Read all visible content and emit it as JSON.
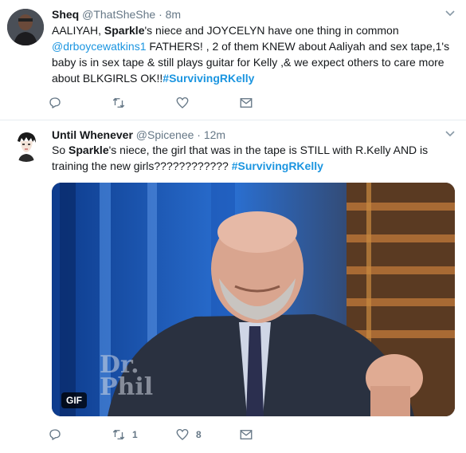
{
  "tweets": [
    {
      "name": "Sheq",
      "handle": "@ThatSheShe",
      "sep": "·",
      "time": "8m",
      "text": {
        "p1": "AALIYAH, ",
        "b1": "Sparkle",
        "p2": "'s niece and JOYCELYN have one thing in common ",
        "mention": "@drboycewatkins1",
        "p3": "  FATHERS! , 2 of them KNEW about Aaliyah and sex tape,1's baby is in sex tape & still  plays guitar for Kelly ,& we expect others to care more about BLKGIRLS OK!!",
        "hashtag": "#SurvivingRKelly"
      },
      "actions": {
        "reply": "",
        "retweet": "",
        "like": ""
      }
    },
    {
      "name": "Until Whenever",
      "handle": "@Spicenee",
      "sep": "·",
      "time": "12m",
      "text": {
        "p1": "So ",
        "b1": "Sparkle",
        "p2": "'s niece, the girl that was in the tape is STILL with R.Kelly AND is training the new girls???????????? ",
        "hashtag": "#SurvivingRKelly"
      },
      "media": {
        "badge": "GIF",
        "watermark_line1": "Dr.",
        "watermark_line2": "Phil"
      },
      "actions": {
        "reply": "",
        "retweet": "1",
        "like": "8"
      }
    }
  ],
  "icons": [
    "chevron-down-icon",
    "reply-icon",
    "retweet-icon",
    "like-icon",
    "message-icon"
  ],
  "colors": {
    "link": "#1b95e0",
    "meta": "#657786",
    "divider": "#e6ecf0"
  }
}
